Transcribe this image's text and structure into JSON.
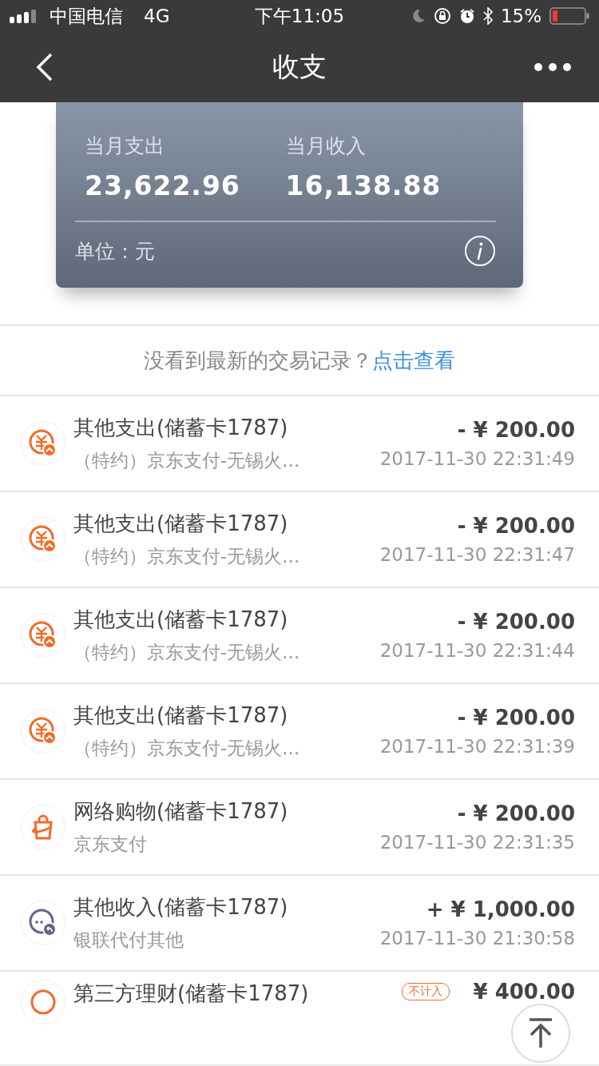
{
  "status_bar": {
    "carrier": "中国电信",
    "network": "4G",
    "time": "下午11:05",
    "battery": "15%"
  },
  "nav": {
    "title": "收支"
  },
  "summary": {
    "expense_label": "当月支出",
    "expense": "23,622.96",
    "income_label": "当月收入",
    "income": "16,138.88",
    "unit": "单位：元"
  },
  "notice": {
    "text": "没看到最新的交易记录？",
    "link": "点击查看"
  },
  "transactions": [
    {
      "kind": "other",
      "title": "其他支出(储蓄卡1787)",
      "desc": "（特约）京东支付-无锡火...",
      "amount": "- ¥ 200.00",
      "time": "2017-11-30 22:31:49"
    },
    {
      "kind": "other",
      "title": "其他支出(储蓄卡1787)",
      "desc": "（特约）京东支付-无锡火...",
      "amount": "- ¥ 200.00",
      "time": "2017-11-30 22:31:47"
    },
    {
      "kind": "other",
      "title": "其他支出(储蓄卡1787)",
      "desc": "（特约）京东支付-无锡火...",
      "amount": "- ¥ 200.00",
      "time": "2017-11-30 22:31:44"
    },
    {
      "kind": "other",
      "title": "其他支出(储蓄卡1787)",
      "desc": "（特约）京东支付-无锡火...",
      "amount": "- ¥ 200.00",
      "time": "2017-11-30 22:31:39"
    },
    {
      "kind": "shopping",
      "title": "网络购物(储蓄卡1787)",
      "desc": "京东支付",
      "amount": "- ¥ 200.00",
      "time": "2017-11-30 22:31:35"
    },
    {
      "kind": "income",
      "title": "其他收入(储蓄卡1787)",
      "desc": "银联代付其他",
      "amount": "+ ¥ 1,000.00",
      "time": "2017-11-30 21:30:58"
    },
    {
      "kind": "finance",
      "title": "第三方理财(储蓄卡1787)",
      "badge": "不计入",
      "amount": "¥ 400.00"
    }
  ]
}
